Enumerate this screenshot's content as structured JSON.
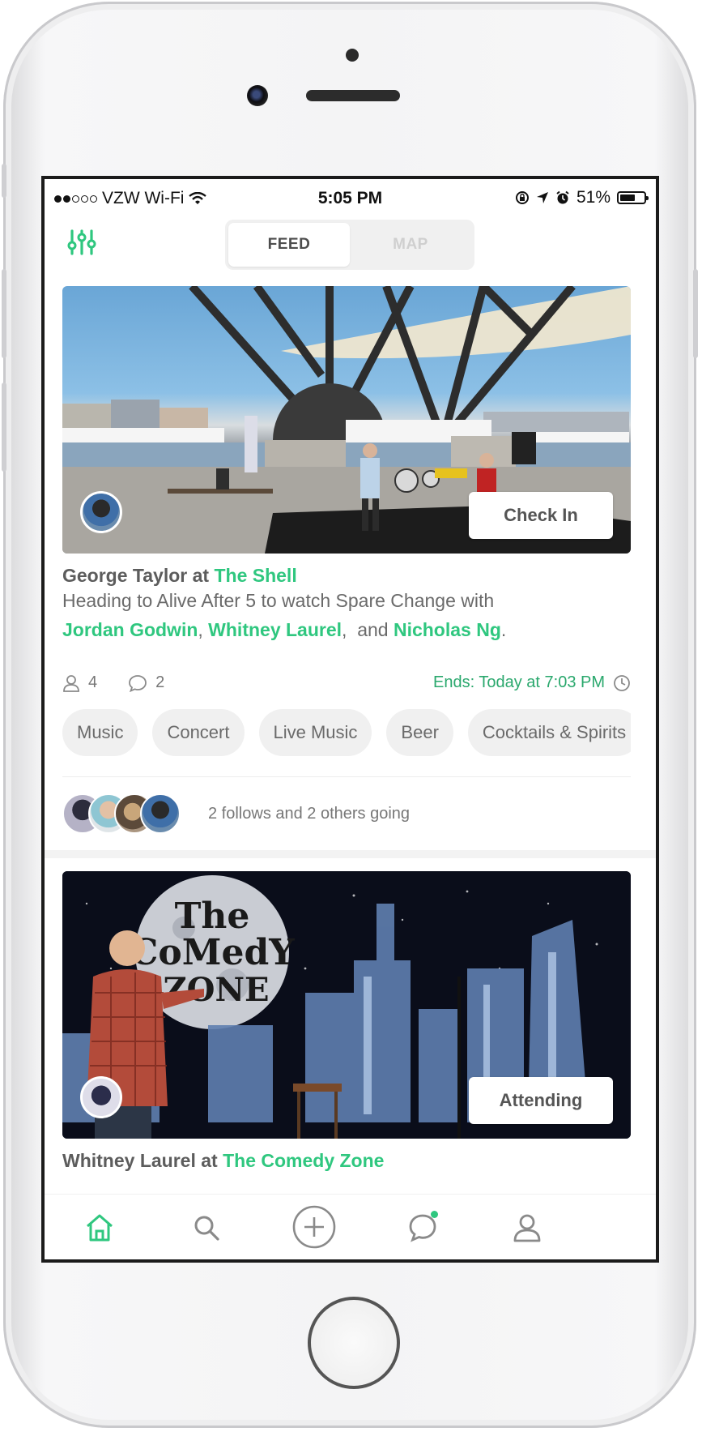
{
  "status_bar": {
    "carrier": "VZW Wi-Fi",
    "time": "5:05 PM",
    "battery": "51%",
    "signal_bars_filled": 2,
    "signal_bars_total": 5
  },
  "top_nav": {
    "filter_icon": "sliders-icon",
    "tabs": [
      {
        "label": "FEED",
        "active": true
      },
      {
        "label": "MAP",
        "active": false
      }
    ]
  },
  "feed": [
    {
      "cta_label": "Check In",
      "poster": "George Taylor",
      "connector": "at",
      "venue": "The Shell",
      "description_prefix": "Heading to  Alive After 5 to watch Spare Change with",
      "people": [
        "Jordan Godwin",
        "Whitney Laurel",
        "Nicholas Ng"
      ],
      "sep_1": ",",
      "sep_2": ",  and",
      "sep_end": ".",
      "attendees_count": "4",
      "comments_count": "2",
      "ends_text": "Ends: Today at 7:03 PM",
      "tags": [
        "Music",
        "Concert",
        "Live Music",
        "Beer",
        "Cocktails & Spirits"
      ],
      "going_text": "2 follows and 2 others going"
    },
    {
      "cta_label": "Attending",
      "poster": "Whitney Laurel",
      "connector": "at",
      "venue": "The Comedy Zone",
      "banner_text": "The CoMedY ZONE"
    }
  ],
  "tab_bar": {
    "items": [
      "home-icon",
      "search-icon",
      "add-icon",
      "chat-icon",
      "profile-icon"
    ],
    "active": "home-icon",
    "chat_has_notification": true
  },
  "colors": {
    "accent": "#2fc77f",
    "accent_dark": "#2aa86d",
    "text_primary": "#5c5c5c",
    "text_secondary": "#777777",
    "tag_bg": "#f0f0f0"
  }
}
